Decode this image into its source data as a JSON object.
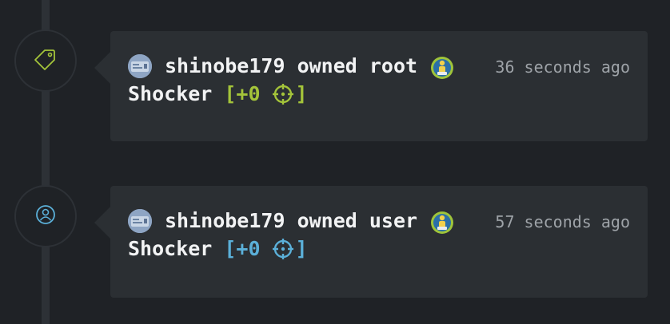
{
  "colors": {
    "root_accent": "#a4c43a",
    "user_accent": "#5bb0d9",
    "card_bg": "#2b2f33",
    "page_bg": "#1f2226"
  },
  "events": [
    {
      "type_icon": "tag-icon",
      "user": "shinobe179",
      "action": "owned root",
      "headline": "shinobe179 owned root",
      "time": "36 seconds ago",
      "machine": "Shocker",
      "points_open": "[+0",
      "points_close": "]",
      "badge_icon": "rank-badge-icon"
    },
    {
      "type_icon": "user-icon",
      "user": "shinobe179",
      "action": "owned user",
      "headline": "shinobe179 owned user",
      "time": "57 seconds ago",
      "machine": "Shocker",
      "points_open": "[+0",
      "points_close": "]",
      "badge_icon": "rank-badge-icon"
    }
  ]
}
